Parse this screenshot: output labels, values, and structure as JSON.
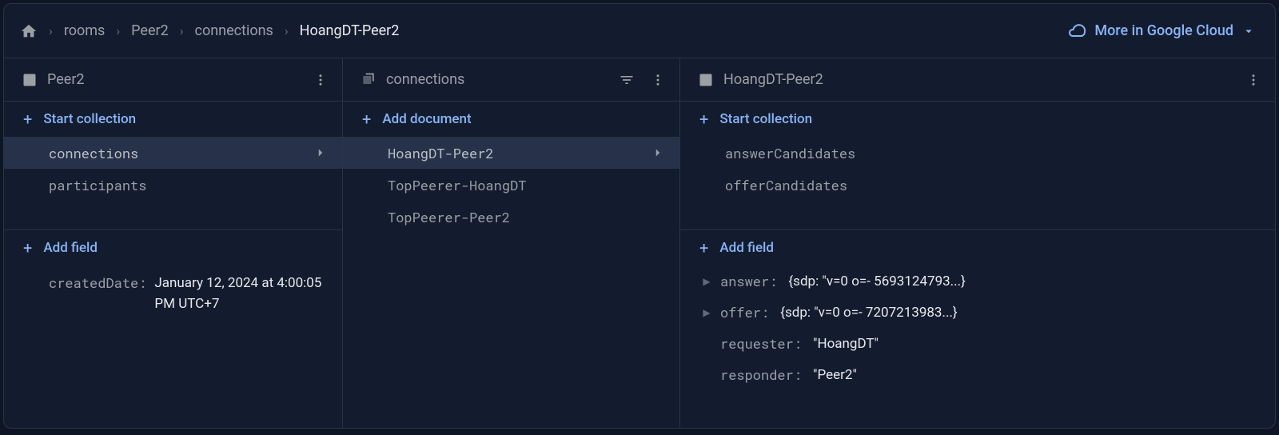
{
  "breadcrumb": {
    "items": [
      "rooms",
      "Peer2",
      "connections",
      "HoangDT-Peer2"
    ]
  },
  "topbar": {
    "more_cloud": "More in Google Cloud"
  },
  "col1": {
    "title": "Peer2",
    "start_collection": "Start collection",
    "collections": [
      {
        "name": "connections",
        "selected": true
      },
      {
        "name": "participants",
        "selected": false
      }
    ],
    "add_field": "Add field",
    "fields": {
      "createdDate_key": "createdDate:",
      "createdDate_val": "January 12, 2024 at 4:00:05 PM UTC+7"
    }
  },
  "col2": {
    "title": "connections",
    "add_document": "Add document",
    "documents": [
      {
        "name": "HoangDT-Peer2",
        "selected": true
      },
      {
        "name": "TopPeerer-HoangDT",
        "selected": false
      },
      {
        "name": "TopPeerer-Peer2",
        "selected": false
      }
    ]
  },
  "col3": {
    "title": "HoangDT-Peer2",
    "start_collection": "Start collection",
    "collections": [
      {
        "name": "answerCandidates"
      },
      {
        "name": "offerCandidates"
      }
    ],
    "add_field": "Add field",
    "fields": [
      {
        "key": "answer:",
        "value": "{sdp: \"v=0 o=- 5693124793...}",
        "expandable": true
      },
      {
        "key": "offer:",
        "value": "{sdp: \"v=0 o=- 7207213983...}",
        "expandable": true
      },
      {
        "key": "requester:",
        "value": "\"HoangDT\"",
        "expandable": false
      },
      {
        "key": "responder:",
        "value": "\"Peer2\"",
        "expandable": false
      }
    ]
  }
}
